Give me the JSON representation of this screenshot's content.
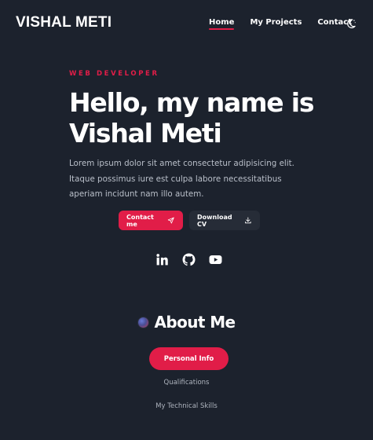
{
  "header": {
    "logo": "VISHAL METI",
    "nav": [
      "Home",
      "My Projects",
      "Contact"
    ],
    "theme_icon": "moon-icon"
  },
  "hero": {
    "subtitle": "WEB DEVELOPER",
    "title": "Hello, my name is Vishal Meti",
    "description": "Lorem ipsum dolor sit amet consectetur adipisicing elit. Itaque possimus iure est culpa labore necessitatibus aperiam incidunt nam illo autem.",
    "contact_label": "Contact me",
    "cv_label": "Download CV"
  },
  "socials": [
    "linkedin-icon",
    "github-icon",
    "youtube-icon"
  ],
  "about": {
    "title": "About Me",
    "tabs": [
      "Personal Info",
      "Qualifications",
      "My Technical Skills"
    ]
  },
  "colors": {
    "accent": "#e11d48",
    "background": "#1c222d",
    "button_dark": "#262c37"
  }
}
